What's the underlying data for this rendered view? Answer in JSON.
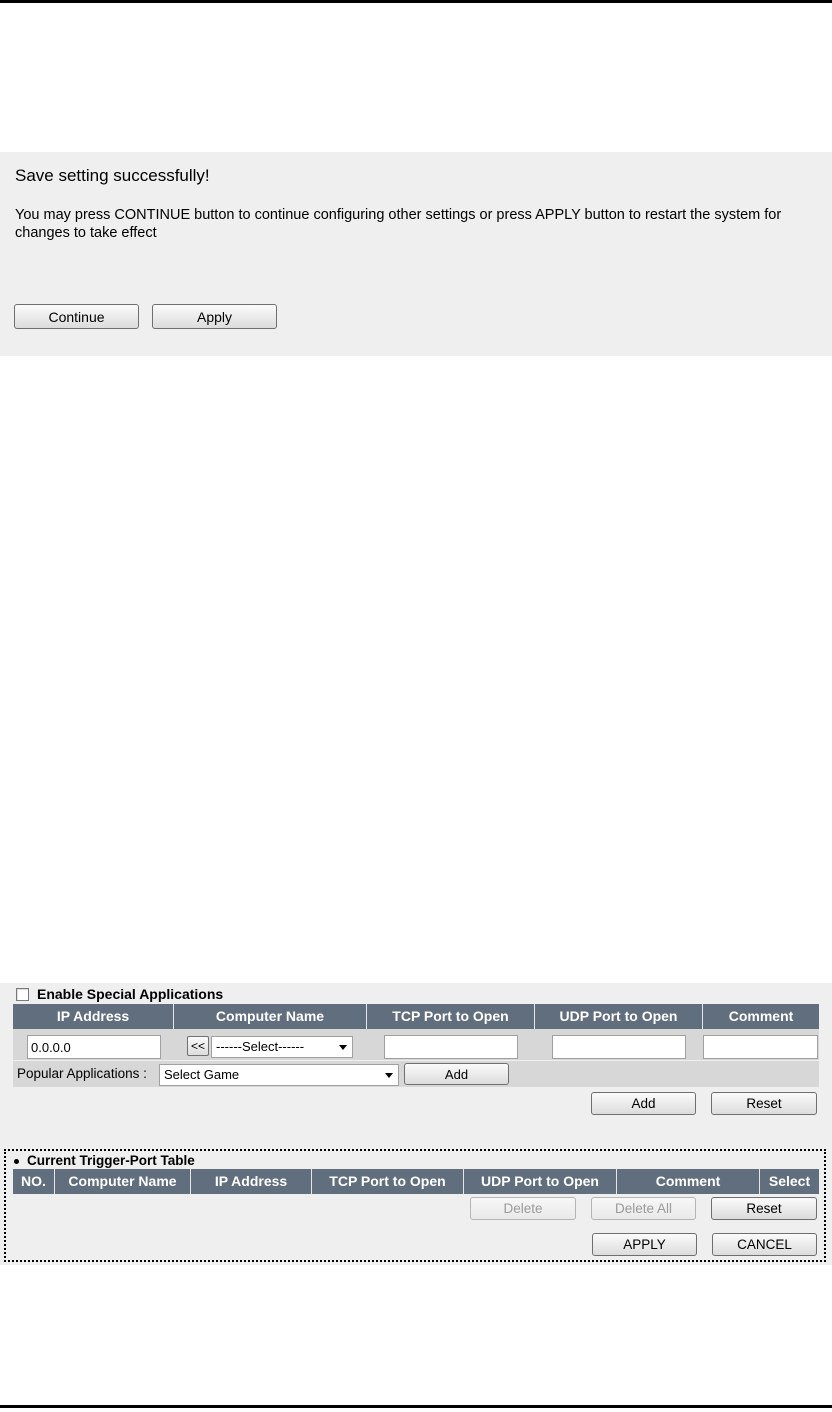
{
  "save_dialog": {
    "title": "Save setting successfully!",
    "message": "You may press CONTINUE button to continue configuring other settings or press APPLY button to restart the system for changes to take effect",
    "continue_label": "Continue",
    "apply_label": "Apply"
  },
  "special_apps": {
    "enable_label": "Enable Special Applications",
    "enabled": false,
    "columns": [
      "IP Address",
      "Computer Name",
      "TCP Port to Open",
      "UDP Port to Open",
      "Comment"
    ],
    "ip_value": "0.0.0.0",
    "copy_label": "<<",
    "computer_select": "------Select------",
    "tcp_value": "",
    "udp_value": "",
    "comment_value": "",
    "popular_label": "Popular Applications :",
    "popular_select": "Select Game",
    "popular_add_label": "Add",
    "add_label": "Add",
    "reset_label": "Reset"
  },
  "trigger_table": {
    "title": "Current Trigger-Port Table",
    "columns": [
      "NO.",
      "Computer Name",
      "IP Address",
      "TCP Port to Open",
      "UDP Port to Open",
      "Comment",
      "Select"
    ],
    "delete_label": "Delete",
    "delete_all_label": "Delete All",
    "reset_label": "Reset",
    "apply_label": "APPLY",
    "cancel_label": "CANCEL"
  },
  "colors": {
    "header_bg": "#606e7e",
    "panel_bg": "#efefef",
    "row_bg": "#d7d7d7"
  }
}
